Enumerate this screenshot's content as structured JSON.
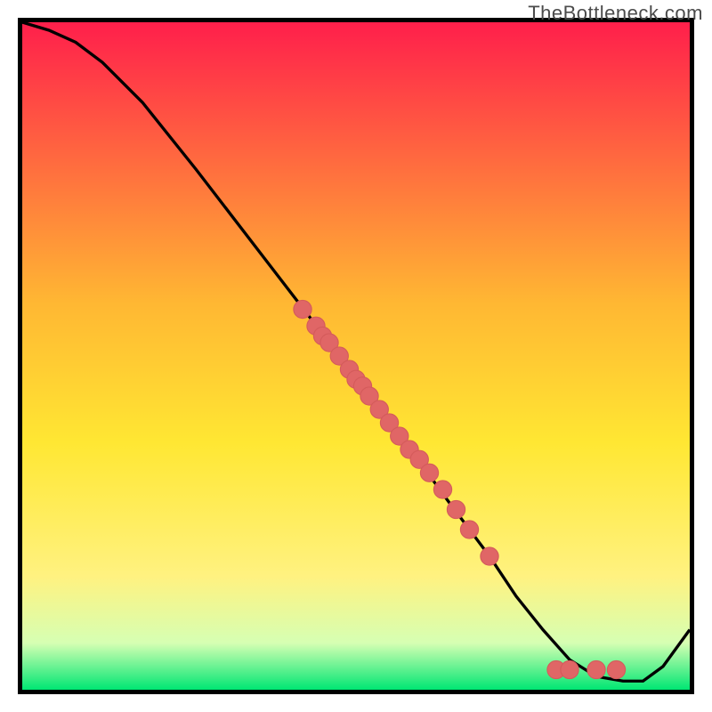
{
  "watermark": "TheBottleneck.com",
  "colors": {
    "top": "#ff1f4b",
    "upper_mid": "#ffb733",
    "mid": "#ffe733",
    "lower_mid": "#fff280",
    "near_bottom": "#d6ffb3",
    "bottom": "#00e673",
    "curve": "#000000",
    "point_fill": "#e06666",
    "point_stroke": "#d45b5b"
  },
  "chart_data": {
    "type": "line",
    "title": "",
    "xlabel": "",
    "ylabel": "",
    "xlim": [
      0,
      100
    ],
    "ylim": [
      0,
      100
    ],
    "curve": {
      "x": [
        0,
        4,
        8,
        12,
        18,
        26,
        36,
        46,
        56,
        64,
        70,
        74,
        78,
        82,
        86,
        90,
        93,
        96,
        100
      ],
      "y": [
        100,
        98.8,
        97,
        94,
        88,
        78,
        65,
        52,
        39,
        28,
        20,
        14,
        9,
        4.5,
        2,
        1.3,
        1.3,
        3.5,
        9
      ]
    },
    "series": [
      {
        "name": "points",
        "x": [
          42,
          44,
          45,
          46,
          47.5,
          49,
          50,
          51,
          52,
          53.5,
          55,
          56.5,
          58,
          59.5,
          61,
          63,
          65,
          67,
          70,
          80,
          82,
          86,
          89
        ],
        "y": [
          57,
          54.5,
          53,
          52,
          50,
          48,
          46.5,
          45.5,
          44,
          42,
          40,
          38,
          36,
          34.5,
          32.5,
          30,
          27,
          24,
          20,
          3,
          3,
          3,
          3
        ]
      }
    ]
  }
}
